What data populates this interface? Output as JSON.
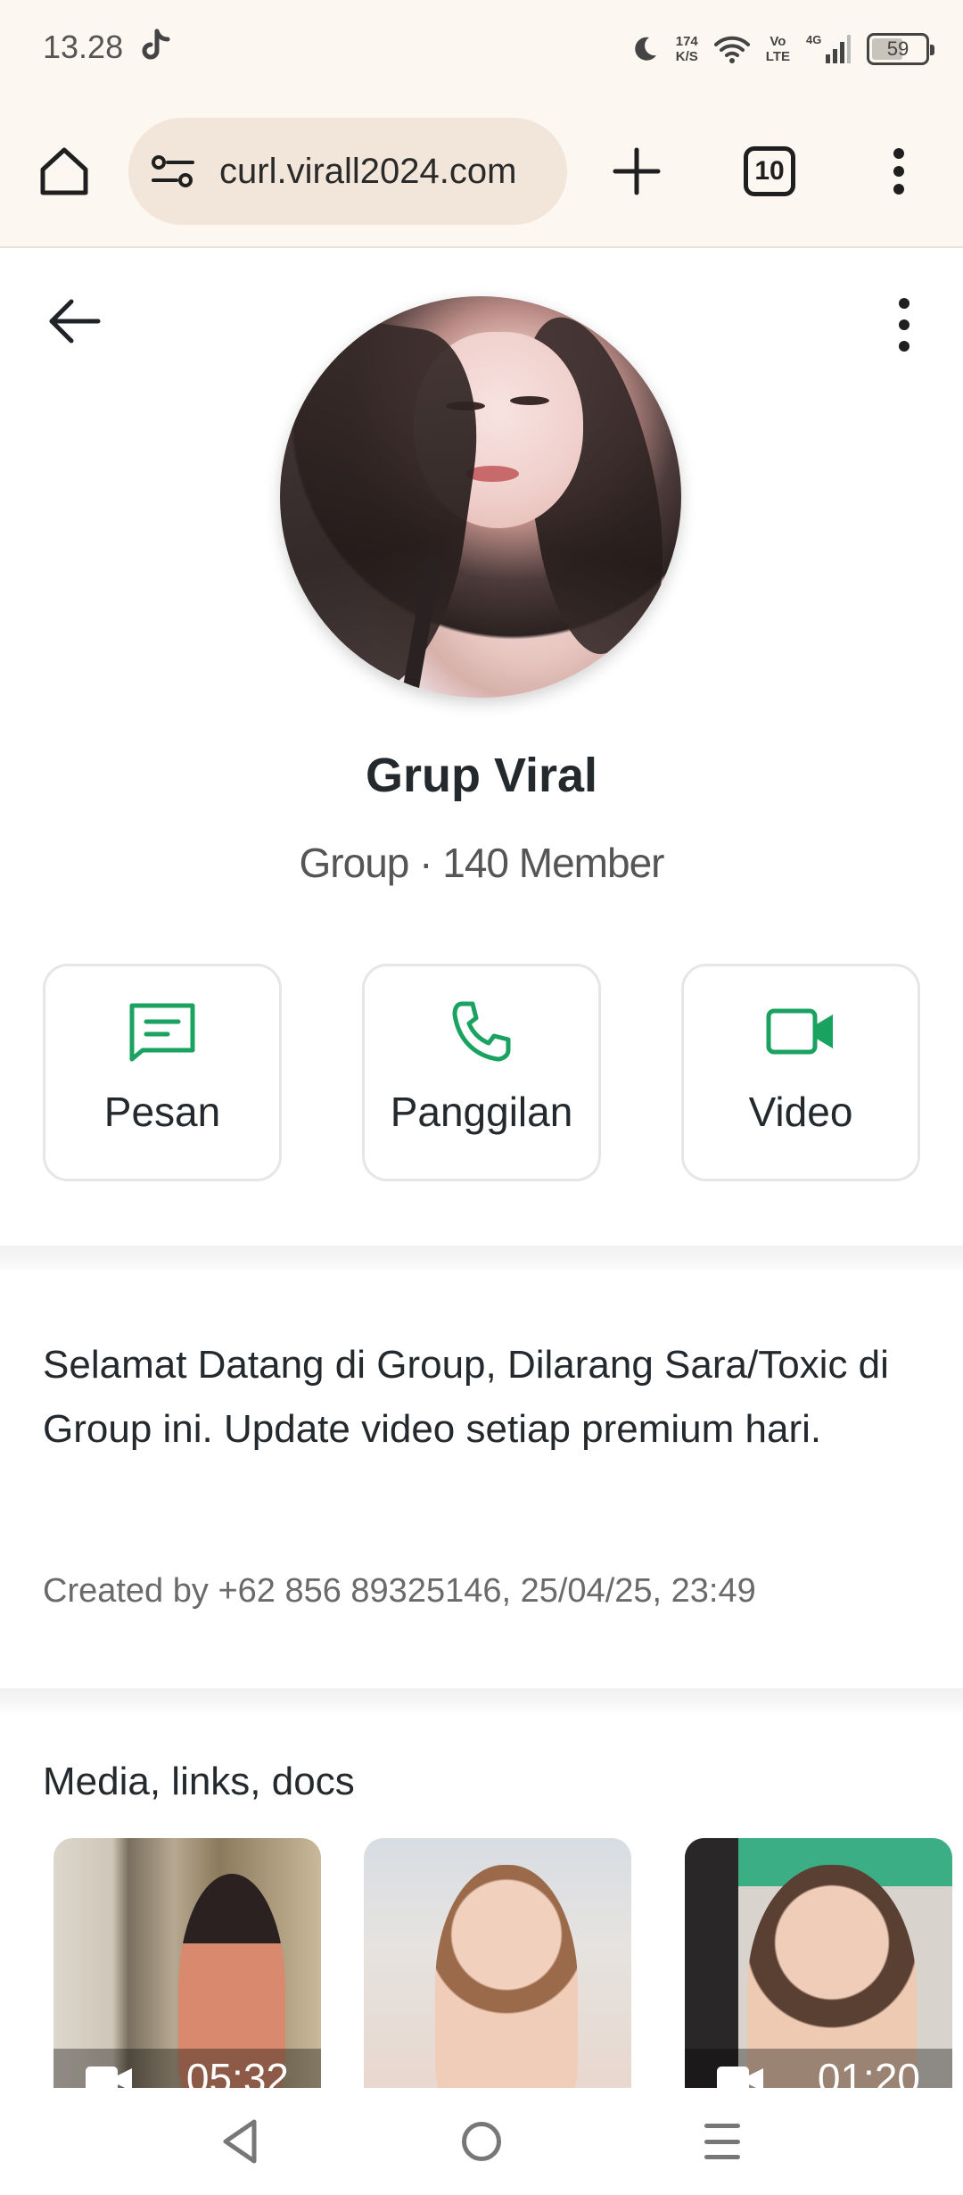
{
  "status_bar": {
    "time": "13.28",
    "net_speed_value": "174",
    "net_speed_unit": "K/S",
    "volte_top": "Vo",
    "volte_bottom": "LTE",
    "network": "4G",
    "battery": "59",
    "battery_level": 0.59
  },
  "browser": {
    "url": "curl.virall2024.com",
    "tab_count": "10"
  },
  "profile": {
    "name": "Grup Viral",
    "meta": "Group · 140 Member"
  },
  "actions": [
    {
      "label": "Pesan",
      "icon": "message-icon"
    },
    {
      "label": "Panggilan",
      "icon": "phone-icon"
    },
    {
      "label": "Video",
      "icon": "video-icon"
    }
  ],
  "description": {
    "text": "Selamat Datang di Group, Dilarang Sara/Toxic di Group ini. Update video setiap premium hari.",
    "created": "Created by +62 856 89325146, 25/04/25, 23:49"
  },
  "media": {
    "title": "Media, links, docs",
    "items": [
      {
        "duration": "05:32"
      },
      {
        "duration": ""
      },
      {
        "duration": "01:20"
      }
    ]
  },
  "colors": {
    "accent_green": "#1aa260",
    "browser_bg": "#fcf7f1",
    "url_pill": "#f2e6da"
  }
}
